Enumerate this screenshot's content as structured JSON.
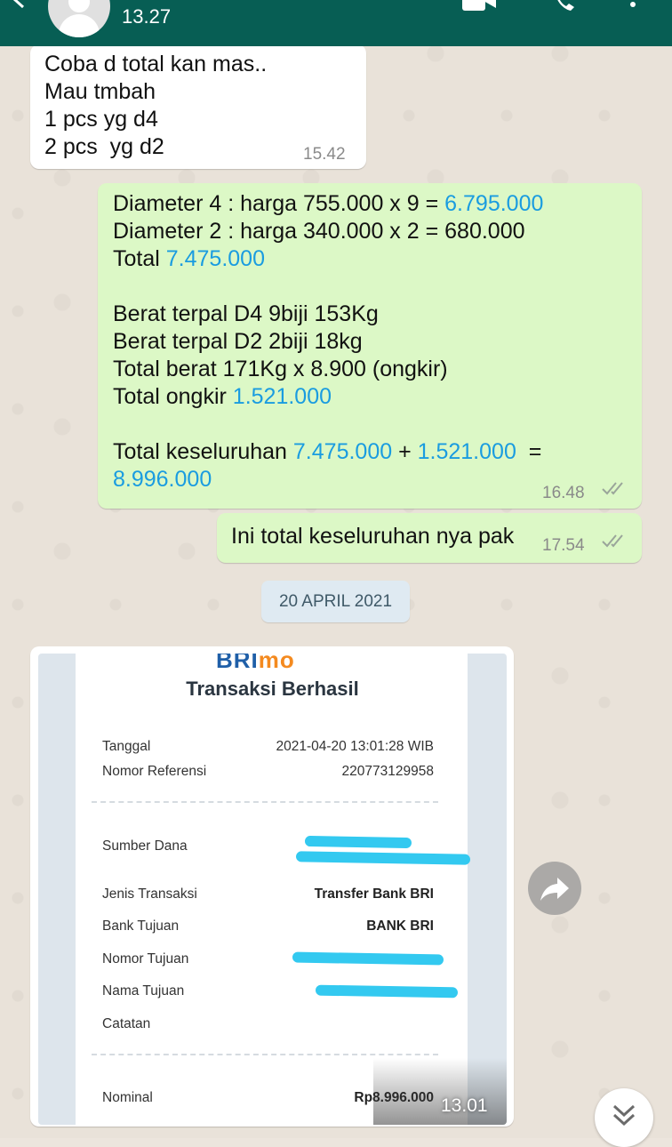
{
  "header": {
    "status": "13.27",
    "back_icon": "arrow-left-icon",
    "video_icon": "video-call-icon",
    "call_icon": "phone-icon",
    "menu_icon": "more-vertical-icon",
    "bar_color": "#075e54"
  },
  "messages": {
    "m1": {
      "lines": [
        "Coba d total kan mas..",
        "Mau tmbah",
        "1 pcs yg d4",
        "2 pcs  yg d2"
      ],
      "time": "15.42"
    },
    "m2": {
      "l1_pre": "Diameter 4 : harga 755.000 x 9 = ",
      "l1_num": "6.795.000",
      "l2": "Diameter 2 : harga 340.000 x 2 = 680.000",
      "l3_pre": "Total ",
      "l3_num": "7.475.000",
      "l5": "Berat terpal D4 9biji 153Kg",
      "l6": "Berat terpal D2 2biji 18kg",
      "l7": "Total berat 171Kg x 8.900 (ongkir)",
      "l8_pre": "Total ongkir ",
      "l8_num": "1.521.000",
      "l10_pre": "Total keseluruhan ",
      "l10_num1": "7.475.000",
      "l10_mid": " + ",
      "l10_num2": "1.521.000",
      "l10_end": "  =",
      "l11_num": "8.996.000",
      "time": "16.48"
    },
    "m3": {
      "text": "Ini total keseluruhan nya pak",
      "time": "17.54"
    }
  },
  "date_chip": "20 APRIL 2021",
  "receipt": {
    "logo_main": "BRI",
    "logo_accent": "mo",
    "title": "Transaksi Berhasil",
    "rows": [
      {
        "label": "Tanggal",
        "value": "2021-04-20 13:01:28 WIB"
      },
      {
        "label": "Nomor Referensi",
        "value": "220773129958"
      },
      {
        "label": "Sumber Dana",
        "value": ""
      },
      {
        "label": "Jenis Transaksi",
        "value": "Transfer Bank BRI"
      },
      {
        "label": "Bank Tujuan",
        "value": "BANK BRI"
      },
      {
        "label": "Nomor Tujuan",
        "value": ""
      },
      {
        "label": "Nama Tujuan",
        "value": ""
      },
      {
        "label": "Catatan",
        "value": ""
      },
      {
        "label": "Nominal",
        "value": "Rp8.996.000"
      }
    ],
    "time": "13.01"
  },
  "buttons": {
    "forward_icon": "forward-arrow-icon",
    "scroll_icon": "double-chevron-down-icon"
  },
  "colors": {
    "incoming_bubble": "#ffffff",
    "outgoing_bubble": "#dcf8c6",
    "highlight_number": "#1a9ce0",
    "redaction": "#33c9f0"
  }
}
